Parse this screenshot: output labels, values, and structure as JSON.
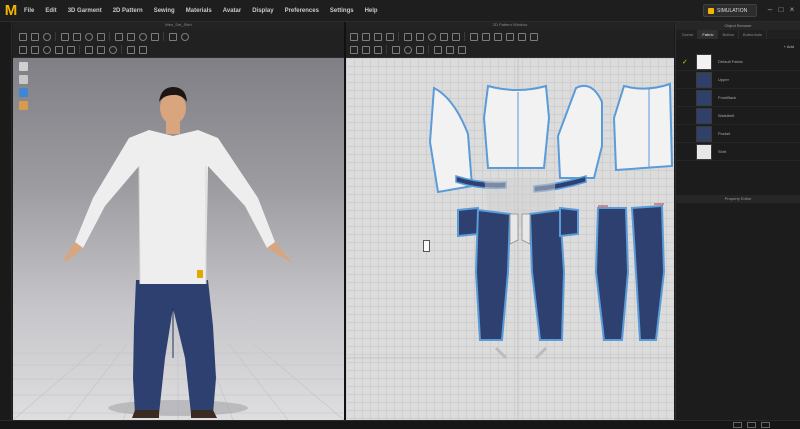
{
  "app": {
    "logo": "M",
    "menu": [
      "File",
      "Edit",
      "3D Garment",
      "2D Pattern",
      "Sewing",
      "Materials",
      "Avatar",
      "Display",
      "Preferences",
      "Settings",
      "Help"
    ],
    "account_label": "",
    "account_value": "",
    "layout_label": "SIMULATION"
  },
  "panel_3d": {
    "title": "Men_Set_Shirt",
    "side_icons": [
      "cube-icon",
      "shirt-icon",
      "globe-icon",
      "avatar-icon"
    ]
  },
  "panel_2d": {
    "title": "2D Pattern Window"
  },
  "right_panel": {
    "title": "Object Browser",
    "tabs": [
      "Scene",
      "Fabric",
      "Button",
      "Buttonhole"
    ],
    "active_tab": "Fabric",
    "add_label": "+ Add",
    "fabrics": [
      {
        "name": "Default Fabric",
        "color": "#f2f2f2",
        "checked": true
      },
      {
        "name": "Upper",
        "color": "#2f4168",
        "checked": false
      },
      {
        "name": "FrontBack",
        "color": "#2f4168",
        "checked": false
      },
      {
        "name": "Waistbelt",
        "color": "#2f4168",
        "checked": false
      },
      {
        "name": "Pocket",
        "color": "#2f4168",
        "checked": false
      },
      {
        "name": "Shirt",
        "color": "#e8e8e8",
        "checked": false
      }
    ],
    "property_title": "Property Editor"
  },
  "colors": {
    "accent": "#f5b400",
    "denim": "#2e4070",
    "pattern_outline": "#5a9bd8",
    "shirt": "#eeeeee"
  },
  "status": {
    "text": ""
  }
}
